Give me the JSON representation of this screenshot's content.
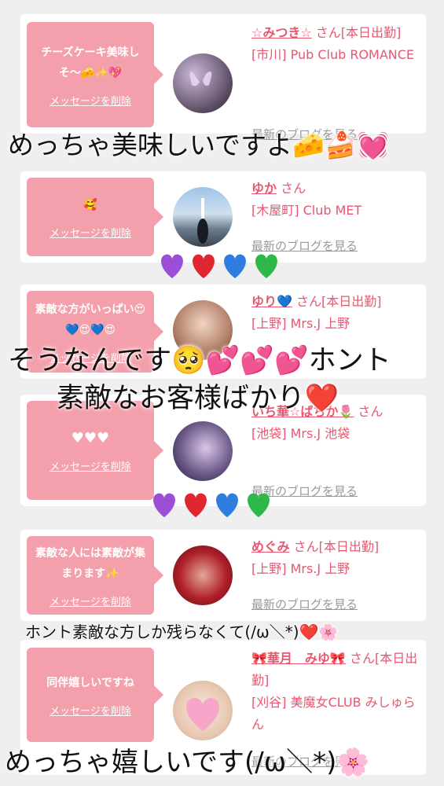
{
  "cards": [
    {
      "message": "チーズケーキ美味しそ〜🧀✨💖",
      "delete_label": "メッセージを削除",
      "name": "☆みつき☆",
      "san": "さん[本日出勤]",
      "store": "[市川] Pub Club ROMANCE",
      "blog": "最新のブログを見る"
    },
    {
      "message": "🥰",
      "delete_label": "メッセージを削除",
      "name": "ゆか",
      "san": "さん",
      "store": "[木屋町] Club MET",
      "blog": "最新のブログを見る"
    },
    {
      "message": "素敵な方がいっぱい😍💙😍💙😍",
      "delete_label": "メッセージを削除",
      "name": "ゆり💙",
      "san": "さん[本日出勤]",
      "store": "[上野] Mrs.J 上野",
      "blog": "最新のブログを見る"
    },
    {
      "message": "♥♥♥",
      "delete_label": "メッセージを削除",
      "name": "いち華☆ぱちか🌷",
      "san": "さん",
      "store": "[池袋] Mrs.J 池袋",
      "blog": "最新のブログを見る"
    },
    {
      "message": "素敵な人には素敵が集まります✨",
      "delete_label": "メッセージを削除",
      "name": "めぐみ",
      "san": "さん[本日出勤]",
      "store": "[上野] Mrs.J 上野",
      "blog": "最新のブログを見る"
    },
    {
      "message": "同伴嬉しいですね",
      "delete_label": "メッセージを削除",
      "name": "🎀華月　みゆ🎀",
      "san": "さん[本日出勤]",
      "store": "[刈谷] 美魔女CLUB みしゅらん",
      "blog": "最新のブログを見る"
    }
  ],
  "overlays": {
    "line1": "めっちゃ美味しいですよ🧀🍰💓",
    "line2": "そうなんです🥺💕💕💕ホント",
    "line3": "素敵なお客様ばかり❤️",
    "line4": "ホント素敵な方しか残らなくて(/ω＼*)❤️🌸",
    "line5": "めっちゃ嬉しいです(/ω＼*)🌸"
  },
  "colors": {
    "accent": "#e8566f",
    "bubble": "#f4a0ac",
    "heart_purple": "#9b4fd6",
    "heart_red": "#e0262f",
    "heart_blue": "#2f7de0",
    "heart_green": "#2fb84a"
  }
}
